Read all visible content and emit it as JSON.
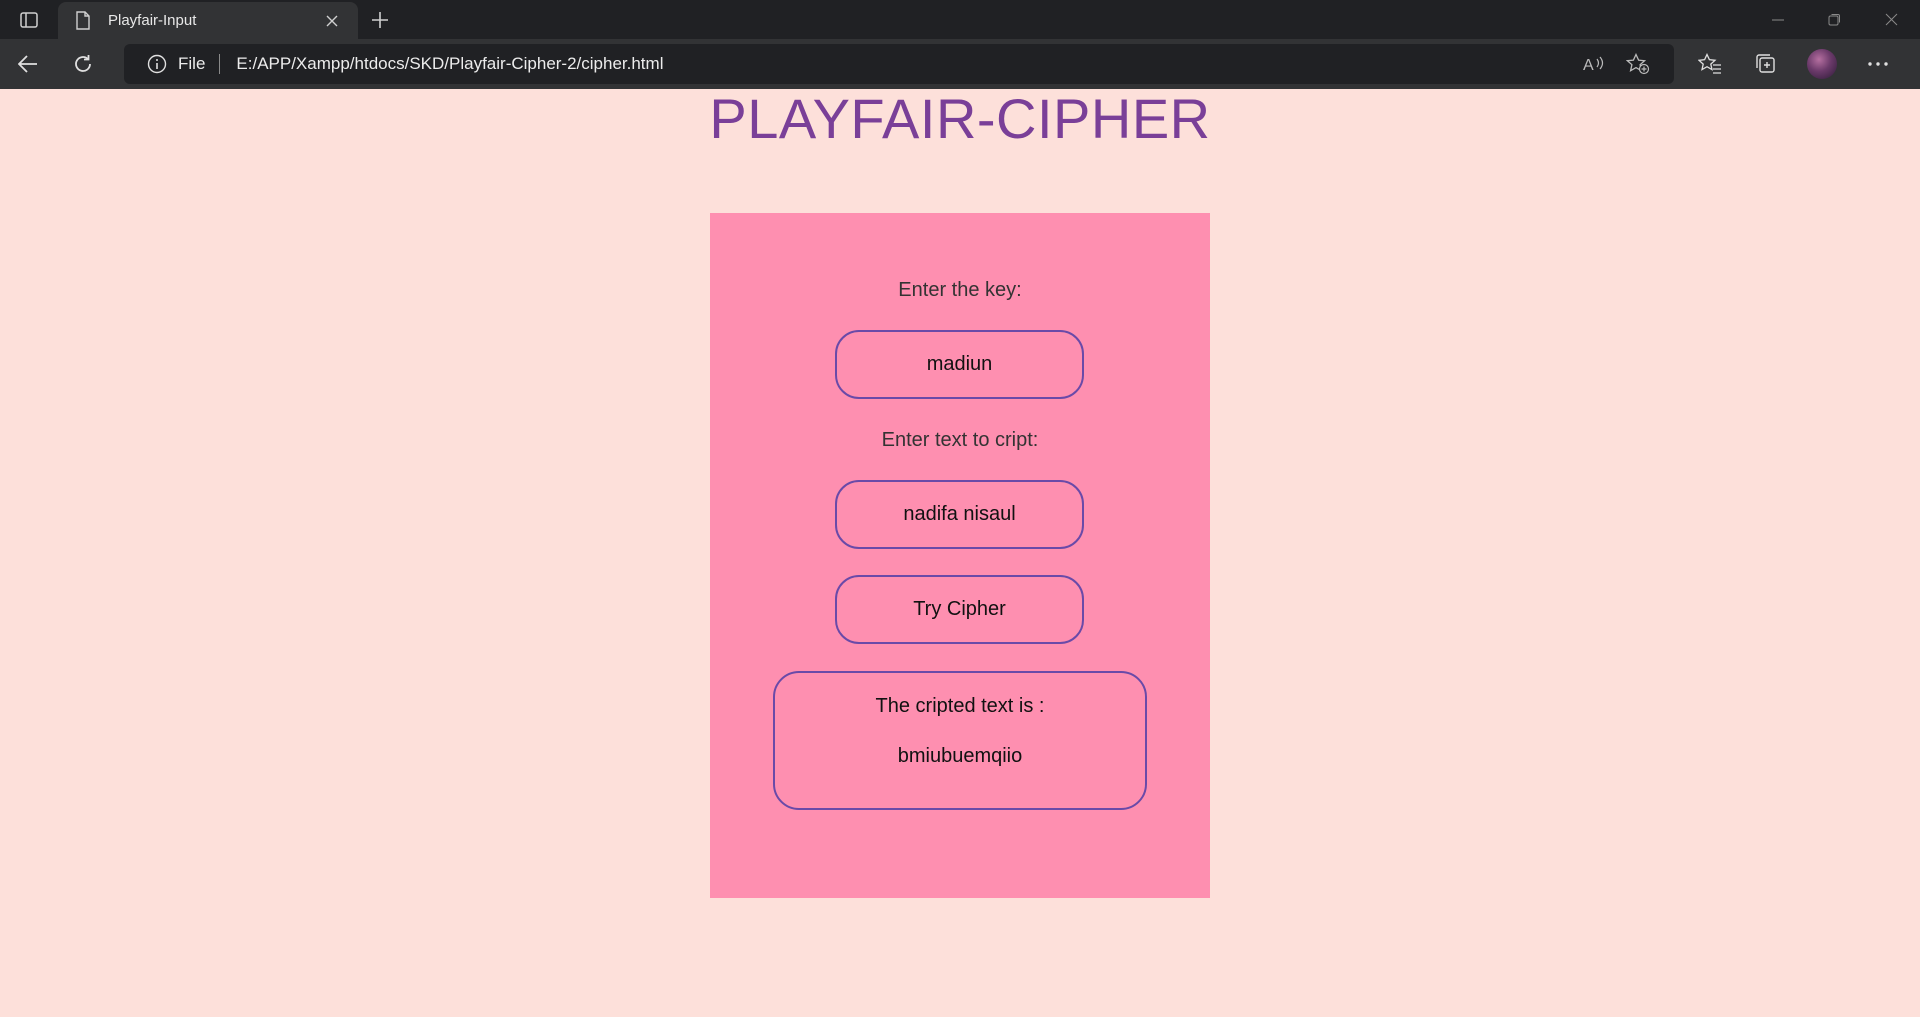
{
  "browser": {
    "tab_title": "Playfair-Input",
    "omnibox_label": "File",
    "url": "E:/APP/Xampp/htdocs/SKD/Playfair-Cipher-2/cipher.html"
  },
  "page": {
    "title": "PLAYFAIR-CIPHER",
    "key_label": "Enter the key:",
    "key_value": "madiun",
    "text_label": "Enter text to cript:",
    "text_value": "nadifa nisaul",
    "submit_label": "Try Cipher",
    "result_label": "The cripted text is :",
    "result_value": "bmiubuemqiio"
  },
  "colors": {
    "page_background": "#fde0da",
    "card_background": "#fe8fb0",
    "title_color": "#7a3f98",
    "border_color": "#6a4aa8"
  }
}
